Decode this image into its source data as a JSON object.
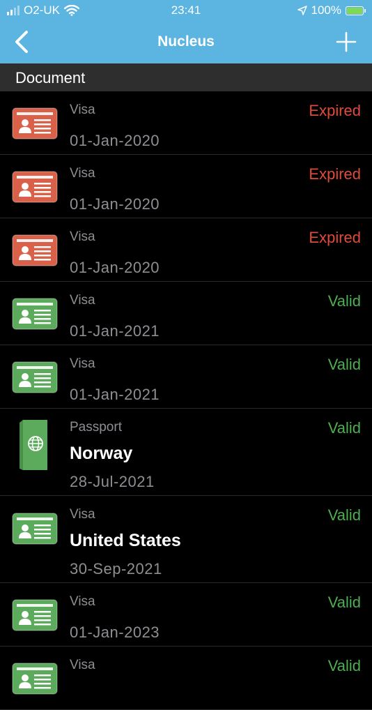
{
  "status_bar": {
    "carrier": "O2-UK",
    "time": "23:41",
    "battery": "100%",
    "icons": [
      "signal-icon",
      "wifi-icon",
      "location-arrow-icon",
      "battery-charging-icon"
    ]
  },
  "nav": {
    "title": "Nucleus",
    "back_icon": "chevron-left-icon",
    "add_icon": "plus-icon"
  },
  "section_header": "Document",
  "colors": {
    "nav_bg": "#5bb5e0",
    "expired": "#e04a3b",
    "valid": "#4caf50",
    "card_expired": "#d9614a",
    "card_valid": "#5caa5c"
  },
  "documents": [
    {
      "type": "Visa",
      "status": "Expired",
      "date": "01-Jan-2020",
      "country": "",
      "icon": "id-card-icon"
    },
    {
      "type": "Visa",
      "status": "Expired",
      "date": "01-Jan-2020",
      "country": "",
      "icon": "id-card-icon"
    },
    {
      "type": "Visa",
      "status": "Expired",
      "date": "01-Jan-2020",
      "country": "",
      "icon": "id-card-icon"
    },
    {
      "type": "Visa",
      "status": "Valid",
      "date": "01-Jan-2021",
      "country": "",
      "icon": "id-card-icon"
    },
    {
      "type": "Visa",
      "status": "Valid",
      "date": "01-Jan-2021",
      "country": "",
      "icon": "id-card-icon"
    },
    {
      "type": "Passport",
      "status": "Valid",
      "date": "28-Jul-2021",
      "country": "Norway",
      "icon": "passport-icon"
    },
    {
      "type": "Visa",
      "status": "Valid",
      "date": "30-Sep-2021",
      "country": "United States",
      "icon": "id-card-icon"
    },
    {
      "type": "Visa",
      "status": "Valid",
      "date": "01-Jan-2023",
      "country": "",
      "icon": "id-card-icon"
    },
    {
      "type": "Visa",
      "status": "Valid",
      "date": "",
      "country": "",
      "icon": "id-card-icon"
    }
  ]
}
